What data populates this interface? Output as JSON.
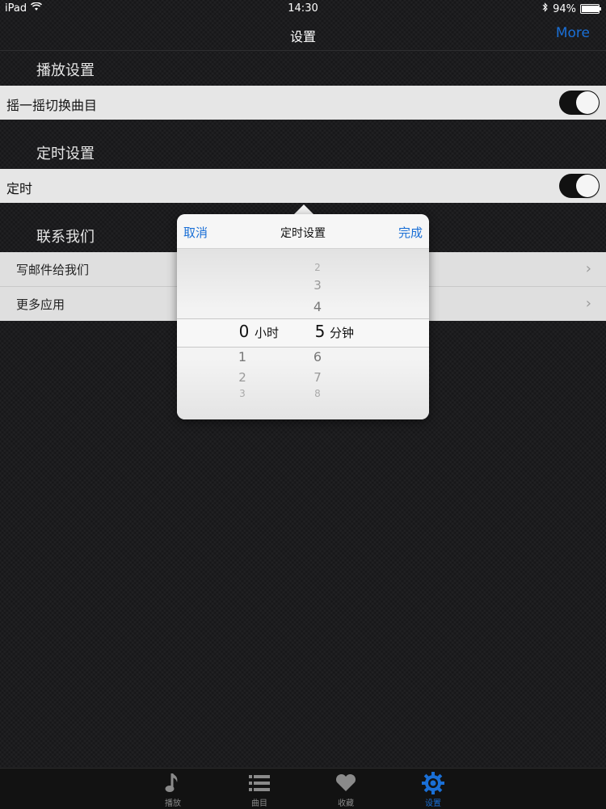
{
  "status_bar": {
    "device": "iPad",
    "time": "14:30",
    "battery": "94%",
    "battery_level": 0.94
  },
  "nav": {
    "title": "设置",
    "more_label": "More"
  },
  "sections": {
    "playback": {
      "header": "播放设置",
      "shake_label": "摇一摇切换曲目",
      "shake_on": true
    },
    "timer": {
      "header": "定时设置",
      "timer_label": "定时",
      "timer_on": true
    },
    "contact": {
      "header": "联系我们",
      "email_label": "写邮件给我们",
      "more_apps_label": "更多应用"
    }
  },
  "popover": {
    "cancel_label": "取消",
    "title": "定时设置",
    "done_label": "完成",
    "hours": {
      "selected": "0",
      "unit": "小时",
      "below": [
        "1",
        "2",
        "3"
      ]
    },
    "minutes": {
      "selected": "5",
      "unit": "分钟",
      "above": [
        "2",
        "3",
        "4"
      ],
      "below": [
        "6",
        "7",
        "8"
      ]
    }
  },
  "tabs": [
    {
      "label": "播放",
      "icon": "music-note-icon"
    },
    {
      "label": "曲目",
      "icon": "list-icon"
    },
    {
      "label": "收藏",
      "icon": "heart-icon"
    },
    {
      "label": "设置",
      "icon": "gear-icon",
      "active": true
    }
  ],
  "colors": {
    "accent": "#1a6fd6",
    "background": "#1c1c1e",
    "row": "#e6e6e6"
  }
}
